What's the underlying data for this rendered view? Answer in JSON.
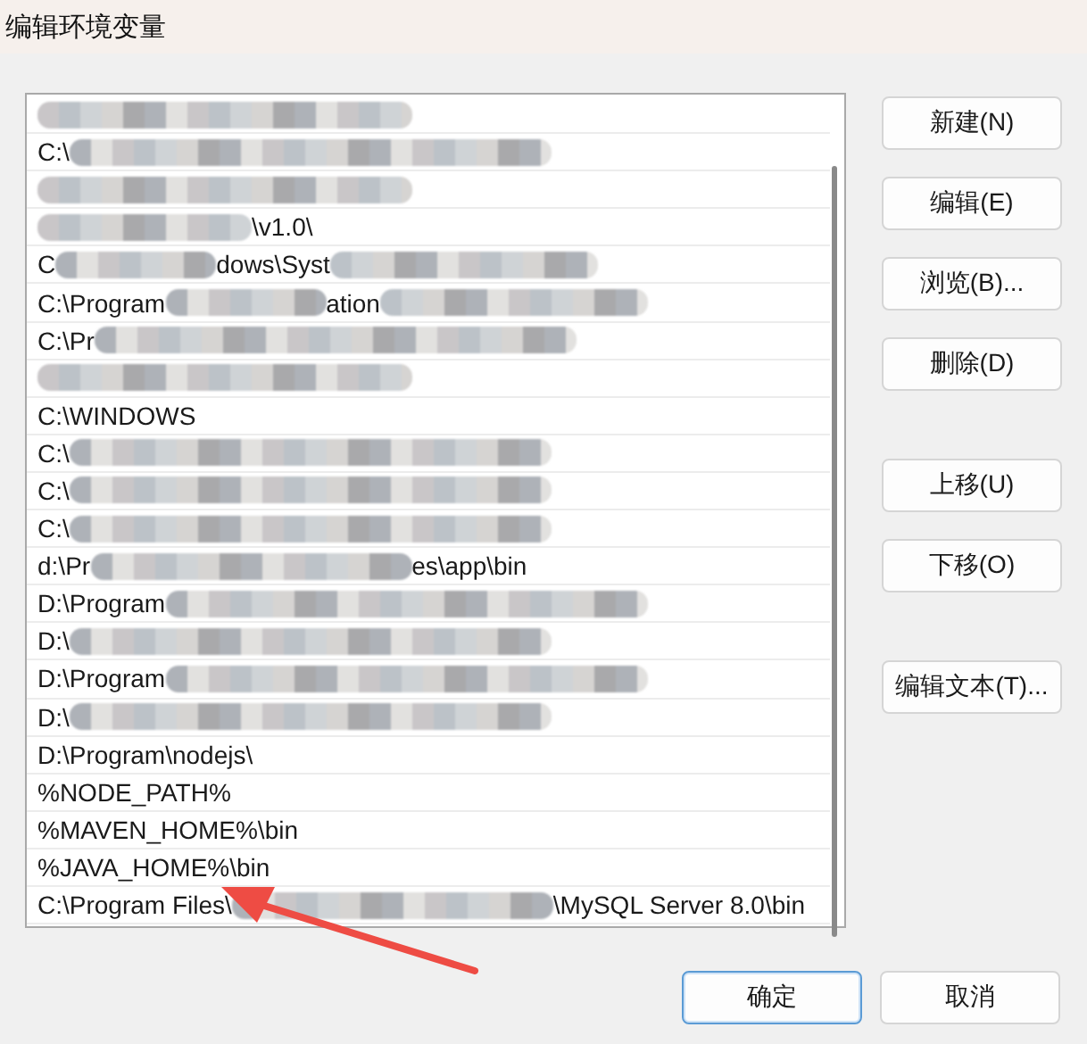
{
  "window": {
    "title": "编辑环境变量"
  },
  "entries": [
    {
      "segments": [
        {
          "kind": "blur"
        }
      ]
    },
    {
      "segments": [
        {
          "kind": "text",
          "text": "C:\\"
        },
        {
          "kind": "blur"
        }
      ]
    },
    {
      "segments": [
        {
          "kind": "blur"
        }
      ]
    },
    {
      "segments": [
        {
          "kind": "blur"
        },
        {
          "kind": "text",
          "text": "\\v1.0\\"
        }
      ]
    },
    {
      "segments": [
        {
          "kind": "text",
          "text": "C"
        },
        {
          "kind": "blur"
        },
        {
          "kind": "text",
          "text": "dows\\Syst"
        },
        {
          "kind": "blur"
        }
      ]
    },
    {
      "segments": [
        {
          "kind": "text",
          "text": "C:\\Program"
        },
        {
          "kind": "blur"
        },
        {
          "kind": "text",
          "text": "ation"
        },
        {
          "kind": "blur"
        }
      ]
    },
    {
      "segments": [
        {
          "kind": "text",
          "text": "C:\\Pr"
        },
        {
          "kind": "blur"
        }
      ]
    },
    {
      "segments": [
        {
          "kind": "blur"
        }
      ]
    },
    {
      "segments": [
        {
          "kind": "text",
          "text": "C:\\WINDOWS"
        }
      ]
    },
    {
      "segments": [
        {
          "kind": "text",
          "text": "C:\\"
        },
        {
          "kind": "blur"
        }
      ]
    },
    {
      "segments": [
        {
          "kind": "text",
          "text": "C:\\"
        },
        {
          "kind": "blur"
        }
      ]
    },
    {
      "segments": [
        {
          "kind": "text",
          "text": "C:\\"
        },
        {
          "kind": "blur"
        }
      ]
    },
    {
      "segments": [
        {
          "kind": "text",
          "text": "d:\\Pr"
        },
        {
          "kind": "blur"
        },
        {
          "kind": "text",
          "text": "es\\app\\bin"
        }
      ]
    },
    {
      "segments": [
        {
          "kind": "text",
          "text": "D:\\Program"
        },
        {
          "kind": "blur"
        }
      ]
    },
    {
      "segments": [
        {
          "kind": "text",
          "text": "D:\\"
        },
        {
          "kind": "blur"
        }
      ]
    },
    {
      "segments": [
        {
          "kind": "text",
          "text": "D:\\Program"
        },
        {
          "kind": "blur"
        }
      ]
    },
    {
      "segments": [
        {
          "kind": "text",
          "text": "D:\\"
        },
        {
          "kind": "blur"
        }
      ]
    },
    {
      "segments": [
        {
          "kind": "text",
          "text": "D:\\Program\\nodejs\\"
        }
      ]
    },
    {
      "segments": [
        {
          "kind": "text",
          "text": "%NODE_PATH%"
        }
      ]
    },
    {
      "segments": [
        {
          "kind": "text",
          "text": "%MAVEN_HOME%\\bin"
        }
      ]
    },
    {
      "segments": [
        {
          "kind": "text",
          "text": "%JAVA_HOME%\\bin"
        }
      ]
    },
    {
      "segments": [
        {
          "kind": "text",
          "text": "C:\\Program Files\\"
        },
        {
          "kind": "blur"
        },
        {
          "kind": "text",
          "text": "\\MySQL Server 8.0\\bin"
        }
      ]
    }
  ],
  "side_button_groups": [
    [
      "新建(N)",
      "编辑(E)",
      "浏览(B)...",
      "删除(D)"
    ],
    [
      "上移(U)",
      "下移(O)"
    ],
    [
      "编辑文本(T)..."
    ]
  ],
  "footer_buttons": [
    {
      "label": "确定",
      "default": true
    },
    {
      "label": "取消",
      "default": false
    }
  ]
}
